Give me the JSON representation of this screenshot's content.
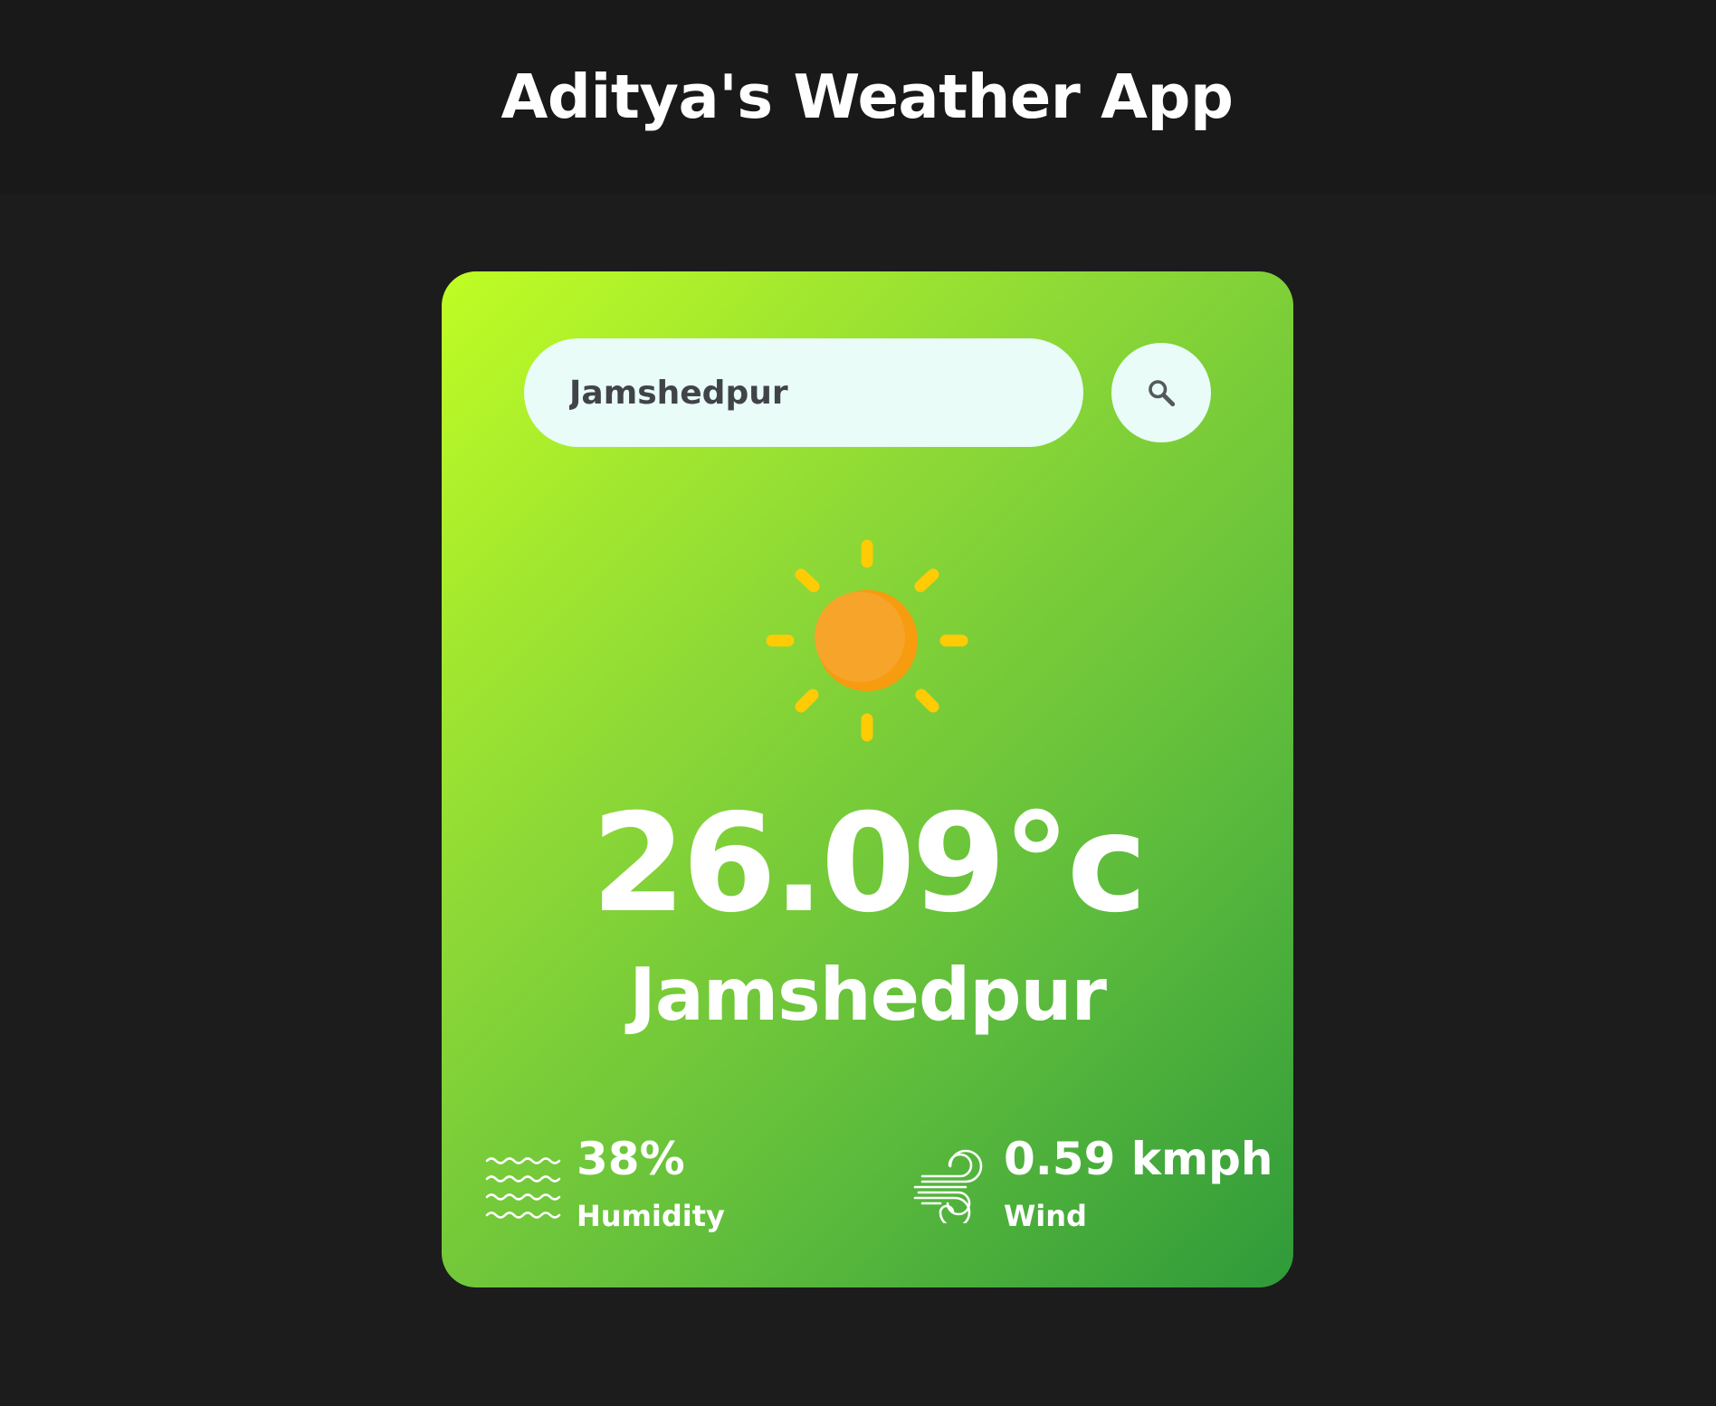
{
  "app": {
    "title": "Aditya's Weather App"
  },
  "search": {
    "value": "Jamshedpur",
    "icon": "search-icon"
  },
  "weather": {
    "icon": "sun-icon",
    "temperature": "26.09°c",
    "city": "Jamshedpur"
  },
  "humidity": {
    "icon": "humidity-icon",
    "value": "38%",
    "label": "Humidity"
  },
  "wind": {
    "icon": "wind-icon",
    "value": "0.59 kmph",
    "label": "Wind"
  },
  "colors": {
    "background": "#1c1c1c",
    "card_gradient_start": "#c0fd24",
    "card_gradient_end": "#2f9a3a",
    "input_background": "#e9fcf8",
    "sun_body": "#f7a42b",
    "sun_rays": "#ffcb05"
  }
}
